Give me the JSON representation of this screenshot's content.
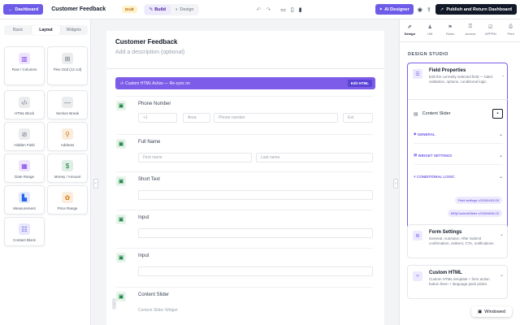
{
  "topbar": {
    "dashboard_label": "Dashboard",
    "form_title": "Customer Feedback",
    "status": "Draft",
    "modes": [
      "Build",
      "Design"
    ],
    "ai_label": "AI Designer",
    "publish_label": "Publish and Return Dashboard"
  },
  "left": {
    "tabs": [
      "Basic",
      "Layout",
      "Widgets"
    ],
    "tiles": [
      {
        "label": "Row / Columns",
        "icon": "columns-icon",
        "color": "#7c3aed"
      },
      {
        "label": "Flex Grid (12 col)",
        "icon": "grid-icon",
        "color": "#6b7280"
      },
      {
        "label": "HTML Block",
        "icon": "code-icon",
        "color": "#6b7280"
      },
      {
        "label": "Section Break",
        "icon": "minus-icon",
        "color": "#6b7280"
      },
      {
        "label": "Hidden Field",
        "icon": "eye-off-icon",
        "color": "#6b7280"
      },
      {
        "label": "Address",
        "icon": "pin-icon",
        "color": "#d97706"
      },
      {
        "label": "Date Range",
        "icon": "calendar-icon",
        "color": "#7c3aed"
      },
      {
        "label": "Money / Amount",
        "icon": "money-icon",
        "color": "#15803d"
      },
      {
        "label": "Measurement",
        "icon": "ruler-icon",
        "color": "#2563eb"
      },
      {
        "label": "Price Range",
        "icon": "tag-icon",
        "color": "#d97706"
      },
      {
        "label": "Contact Block",
        "icon": "contact-icon",
        "color": "#4f46e5"
      }
    ]
  },
  "canvas": {
    "page_title": "Customer Feedback",
    "page_desc": "Add a description (optional)",
    "banner_text": "Custom HTML Active — Re-sync on",
    "edit_html": "Edit HTML",
    "fields": [
      {
        "label": "Phone Number",
        "inputs": [
          "+1",
          "Area",
          "Phone number",
          "Ext"
        ]
      },
      {
        "label": "Full Name",
        "inputs": [
          "First name",
          "Last name"
        ]
      },
      {
        "label": "Short Text",
        "inputs": [
          ""
        ]
      },
      {
        "label": "Input",
        "inputs": [
          ""
        ]
      },
      {
        "label": "Input",
        "inputs": [
          ""
        ]
      },
      {
        "label": "Content Slider",
        "inputs": [
          "Content Slider Widget"
        ]
      }
    ]
  },
  "right": {
    "tabs": [
      "Design",
      "UM",
      "Rules",
      "Access",
      "APPRN",
      "Print"
    ],
    "studio_title": "DESIGN STUDIO",
    "field_props": {
      "title": "Field Properties",
      "desc": "Edit the currently selected field — label, validation, options, conditional logic.",
      "selected": "Content Slider",
      "sections": [
        "GENERAL",
        "WIDGET SETTINGS",
        "CONDITIONAL LOGIC"
      ],
      "pills": [
        "Field settings v20260403-05",
        "MRjrContentSlider v20260626-03"
      ]
    },
    "form_settings": {
      "title": "Form Settings",
      "desc": "General, Autosave, After Submit confirmation, redirect, CTA, notifications"
    },
    "custom_html": {
      "title": "Custom HTML",
      "desc": "Custom HTML template + form action button them + language pack picker"
    }
  },
  "windowed_label": "Windowed"
}
